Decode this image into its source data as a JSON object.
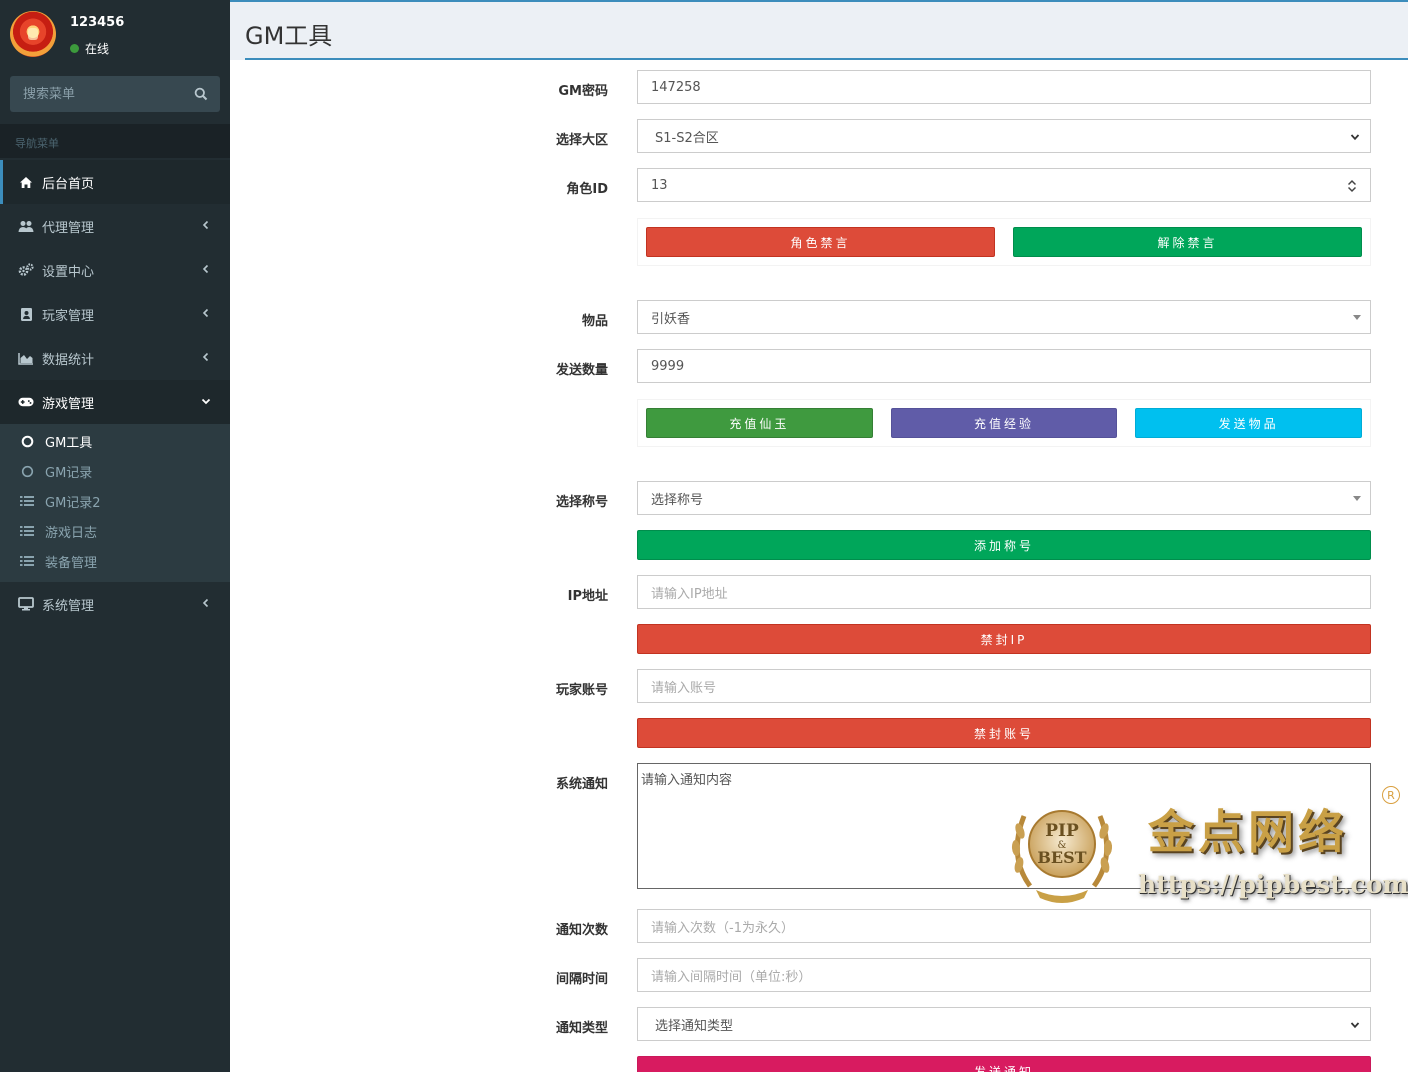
{
  "user": {
    "name": "123456",
    "status": "在线"
  },
  "search": {
    "placeholder": "搜索菜单"
  },
  "nav_header": "导航菜单",
  "menu": [
    {
      "label": "后台首页",
      "icon": "home-icon"
    },
    {
      "label": "代理管理",
      "icon": "users-icon"
    },
    {
      "label": "设置中心",
      "icon": "cogs-icon"
    },
    {
      "label": "玩家管理",
      "icon": "id-card-icon"
    },
    {
      "label": "数据统计",
      "icon": "area-chart-icon"
    },
    {
      "label": "游戏管理",
      "icon": "gamepad-icon"
    },
    {
      "label": "系统管理",
      "icon": "desktop-icon"
    }
  ],
  "submenu": [
    {
      "label": "GM工具",
      "icon": "circle-icon"
    },
    {
      "label": "GM记录",
      "icon": "circle-icon"
    },
    {
      "label": "GM记录2",
      "icon": "list-icon"
    },
    {
      "label": "游戏日志",
      "icon": "list-icon"
    },
    {
      "label": "装备管理",
      "icon": "list-icon"
    }
  ],
  "page": {
    "title": "GM工具"
  },
  "form": {
    "gm_password": {
      "label": "GM密码",
      "value": "147258"
    },
    "server": {
      "label": "选择大区",
      "value": "S1-S2合区"
    },
    "role_id": {
      "label": "角色ID",
      "value": "13"
    },
    "mute_btn": "角色禁言",
    "unmute_btn": "解除禁言",
    "item": {
      "label": "物品",
      "value": "引妖香"
    },
    "send_qty": {
      "label": "发送数量",
      "value": "9999"
    },
    "recharge_jade_btn": "充值仙玉",
    "recharge_exp_btn": "充值经验",
    "send_item_btn": "发送物品",
    "title_select": {
      "label": "选择称号",
      "value": "选择称号"
    },
    "add_title_btn": "添加称号",
    "ip": {
      "label": "IP地址",
      "placeholder": "请输入IP地址"
    },
    "ban_ip_btn": "禁封IP",
    "account": {
      "label": "玩家账号",
      "placeholder": "请输入账号"
    },
    "ban_account_btn": "禁封账号",
    "notice": {
      "label": "系统通知",
      "placeholder": "请输入通知内容"
    },
    "notice_count": {
      "label": "通知次数",
      "placeholder": "请输入次数（-1为永久）"
    },
    "interval": {
      "label": "间隔时间",
      "placeholder": "请输入间隔时间（单位:秒）"
    },
    "notice_type": {
      "label": "通知类型",
      "value": "选择通知类型"
    },
    "send_notice_btn": "发送通知"
  },
  "watermark": {
    "logo_text_1": "PIP",
    "logo_text_2": "&",
    "logo_text_3": "BEST",
    "title": "金点网络",
    "url": "https://pipbest.com",
    "reg": "R"
  },
  "colors": {
    "sidebar_bg": "#222d32",
    "accent": "#3c8dbc",
    "red": "#dd4b39",
    "green": "#00a65a",
    "purple": "#605ca8",
    "aqua": "#00c0ef",
    "maroon": "#d81b60"
  }
}
